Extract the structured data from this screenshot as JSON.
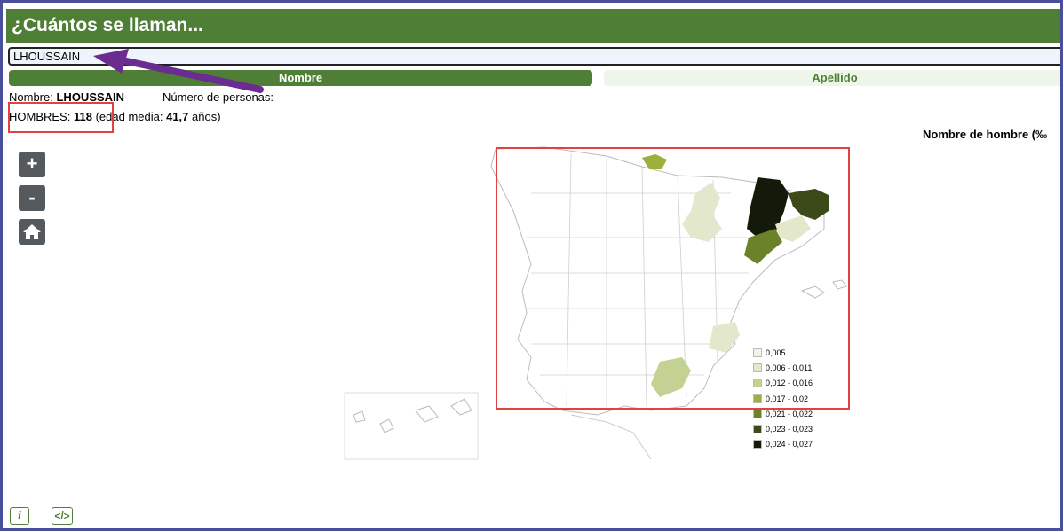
{
  "header": {
    "title": "¿Cuántos se llaman..."
  },
  "search": {
    "value": "LHOUSSAIN"
  },
  "tabs": [
    {
      "label": "Nombre"
    },
    {
      "label": "Apellido"
    }
  ],
  "info": {
    "nombre_label": "Nombre:",
    "nombre_value": "LHOUSSAIN",
    "personas_label": "Número de personas:",
    "hombres_label": "HOMBRES:",
    "hombres_value": "118",
    "edad_prefix": "(edad media:",
    "edad_value": "41,7",
    "edad_suffix": "años)"
  },
  "map": {
    "title": "Nombre de hombre (‰",
    "controls": {
      "zoom_in": "+",
      "zoom_out": "-",
      "home": "home-icon"
    },
    "legend": [
      {
        "label": "0,005",
        "color": "#f1f3e6"
      },
      {
        "label": "0,006 - 0,011",
        "color": "#e3e8cc"
      },
      {
        "label": "0,012 - 0,016",
        "color": "#c3d193"
      },
      {
        "label": "0,017 - 0,02",
        "color": "#9cb03b"
      },
      {
        "label": "0,021 - 0,022",
        "color": "#6b8228"
      },
      {
        "label": "0,023 - 0,023",
        "color": "#3b4a18"
      },
      {
        "label": "0,024 - 0,027",
        "color": "#141a0a"
      }
    ]
  },
  "footer": {
    "info_button": "i",
    "embed_button": "</>"
  },
  "colors": {
    "brand_green": "#4f7f36",
    "highlight_red": "#e0423f",
    "arrow_purple": "#6a2c91"
  }
}
